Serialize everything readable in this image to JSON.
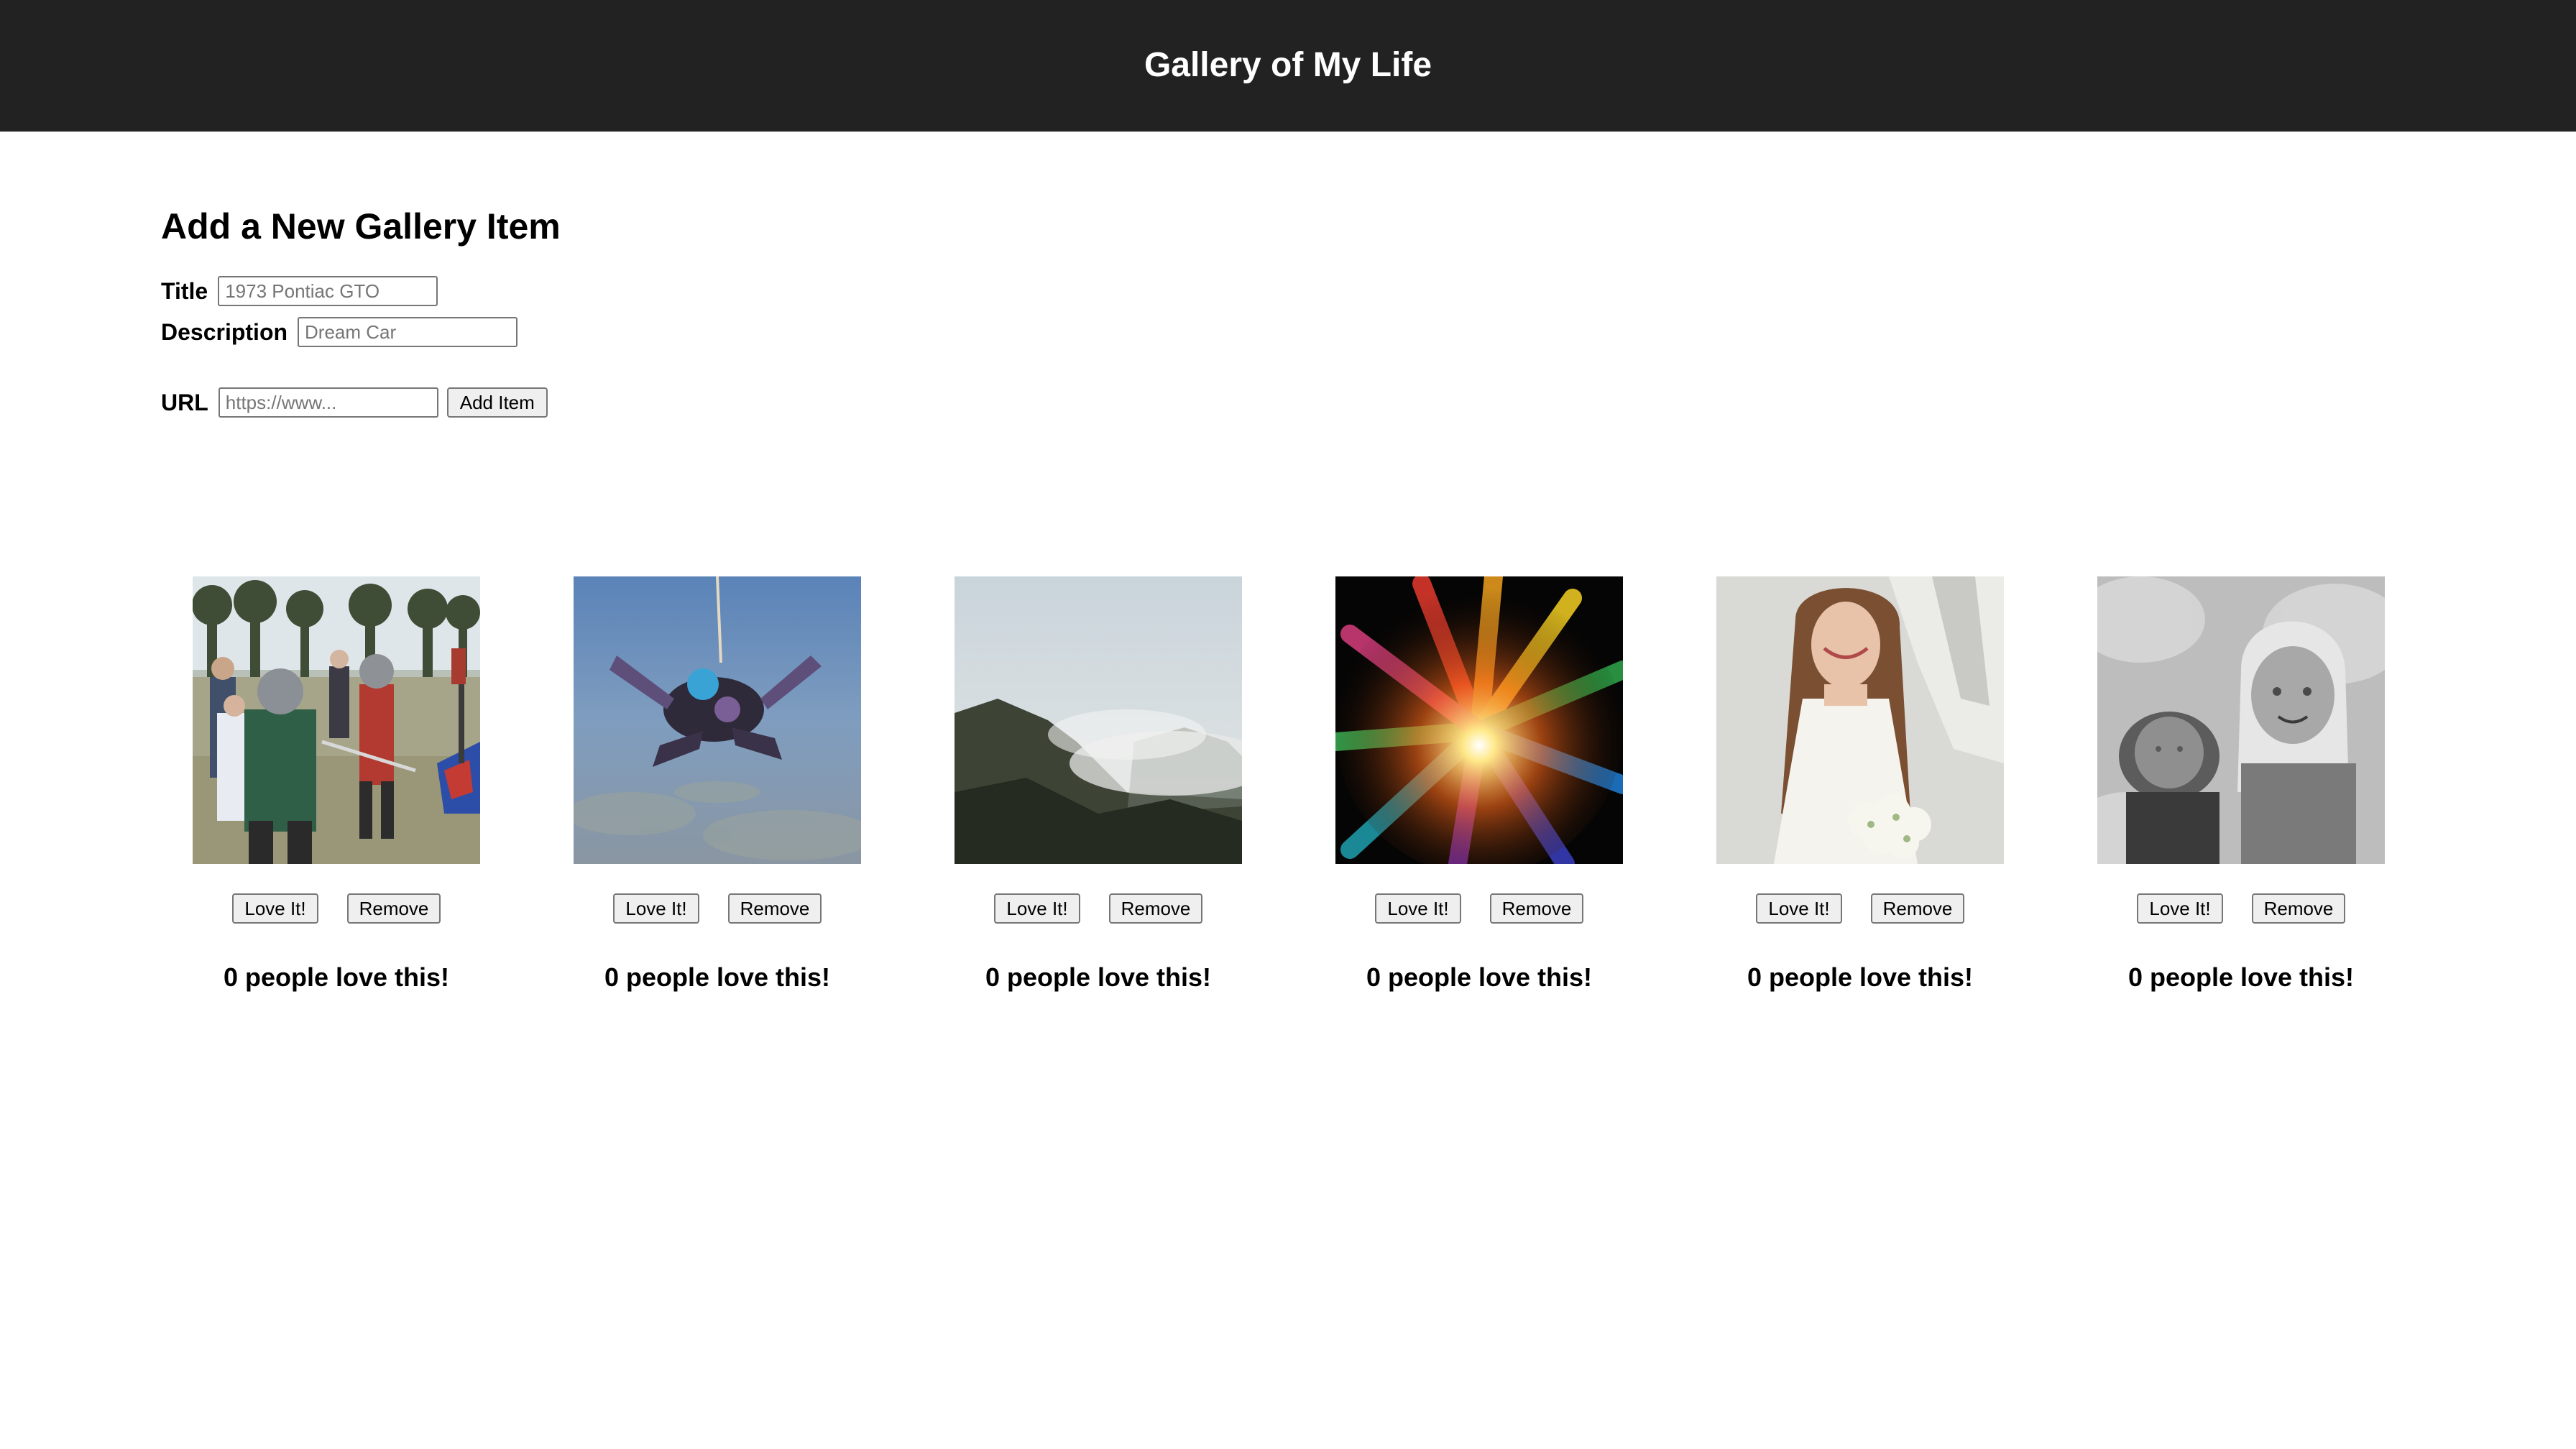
{
  "header": {
    "title": "Gallery of My Life"
  },
  "form": {
    "heading": "Add a New Gallery Item",
    "title_label": "Title",
    "title_placeholder": "1973 Pontiac GTO",
    "title_value": "",
    "description_label": "Description",
    "description_placeholder": "Dream Car",
    "description_value": "",
    "url_label": "URL",
    "url_placeholder": "https://www...",
    "url_value": "",
    "add_button": "Add Item"
  },
  "gallery": {
    "love_button": "Love It!",
    "remove_button": "Remove",
    "items": [
      {
        "image": "knights-sword-fight-photo",
        "love_count": 0,
        "love_text": "0 people love this!"
      },
      {
        "image": "tandem-skydiving-photo",
        "love_count": 0,
        "love_text": "0 people love this!"
      },
      {
        "image": "misty-mountain-valley-photo",
        "love_count": 0,
        "love_text": "0 people love this!"
      },
      {
        "image": "rainbow-light-burst-photo",
        "love_count": 0,
        "love_text": "0 people love this!"
      },
      {
        "image": "bride-with-bouquet-photo",
        "love_count": 0,
        "love_text": "0 people love this!"
      },
      {
        "image": "two-children-bw-photo",
        "love_count": 0,
        "love_text": "0 people love this!"
      }
    ]
  }
}
